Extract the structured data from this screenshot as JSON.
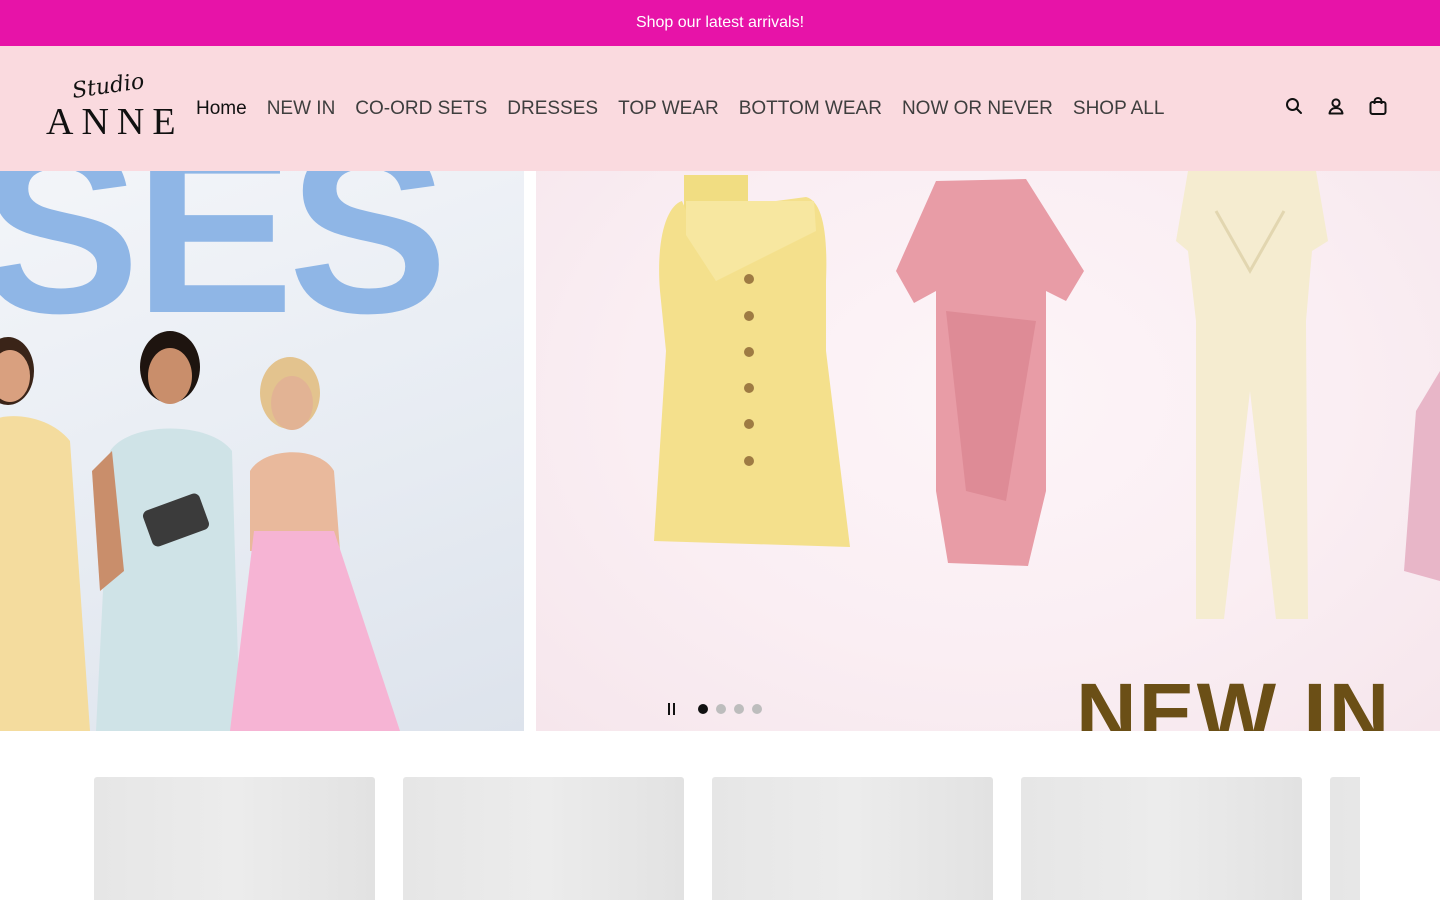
{
  "announcement": {
    "text": "Shop our latest arrivals!",
    "bg_color": "#e713a8"
  },
  "header": {
    "bg_color": "#fadadf",
    "logo": {
      "script": "Studio",
      "word": "ANNE"
    },
    "nav": [
      {
        "label": "Home",
        "active": true
      },
      {
        "label": "NEW IN"
      },
      {
        "label": "CO-ORD SETS"
      },
      {
        "label": "DRESSES"
      },
      {
        "label": "TOP WEAR"
      },
      {
        "label": "BOTTOM WEAR"
      },
      {
        "label": "NOW OR NEVER"
      },
      {
        "label": "SHOP ALL"
      }
    ],
    "icons": [
      "search-icon",
      "account-icon",
      "cart-icon"
    ]
  },
  "hero": {
    "left_slide_text": "SES",
    "right_slide_text": "NEW IN",
    "slide_count": 4,
    "active_slide": 1,
    "dot_active_color": "#111111",
    "dot_inactive_color": "#bdbdbd"
  },
  "products": {
    "placeholder_count": 5
  }
}
